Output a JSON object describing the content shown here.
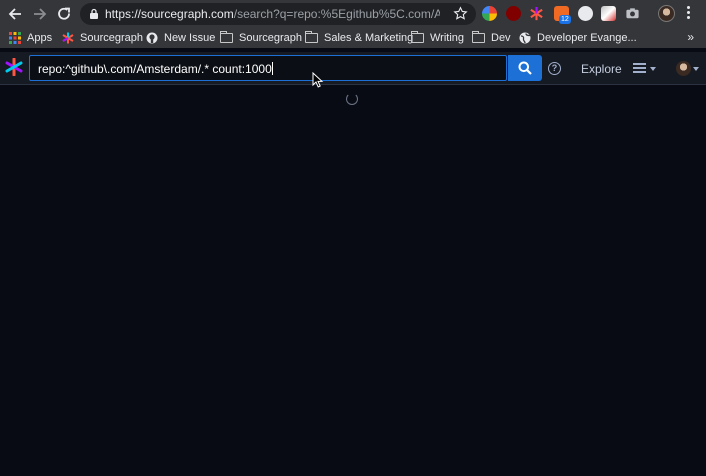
{
  "browser": {
    "url_main": "https://sourcegraph.com",
    "url_path": "/search?q=repo:%5Egithub%5C.com/Am..."
  },
  "bookmarks": [
    {
      "label": "Apps",
      "icon": "apps-grid-icon"
    },
    {
      "label": "Sourcegraph",
      "icon": "sourcegraph-icon"
    },
    {
      "label": "New Issue",
      "icon": "github-icon"
    },
    {
      "label": "Sourcegraph",
      "icon": "folder-icon"
    },
    {
      "label": "Sales & Marketing",
      "icon": "folder-icon"
    },
    {
      "label": "Writing",
      "icon": "folder-icon"
    },
    {
      "label": "Dev",
      "icon": "folder-icon"
    },
    {
      "label": "Developer Evange...",
      "icon": "globe-icon"
    }
  ],
  "extensions": {
    "badge_count": "12"
  },
  "sourcegraph": {
    "query": "repo:^github\\.com/Amsterdam/.* count:1000",
    "explore_label": "Explore",
    "help_glyph": "?"
  },
  "colors": {
    "accent": "#1d70d6",
    "page_bg": "#080b13",
    "navbar_bg": "#161a22",
    "chrome_bg": "#35363a"
  }
}
